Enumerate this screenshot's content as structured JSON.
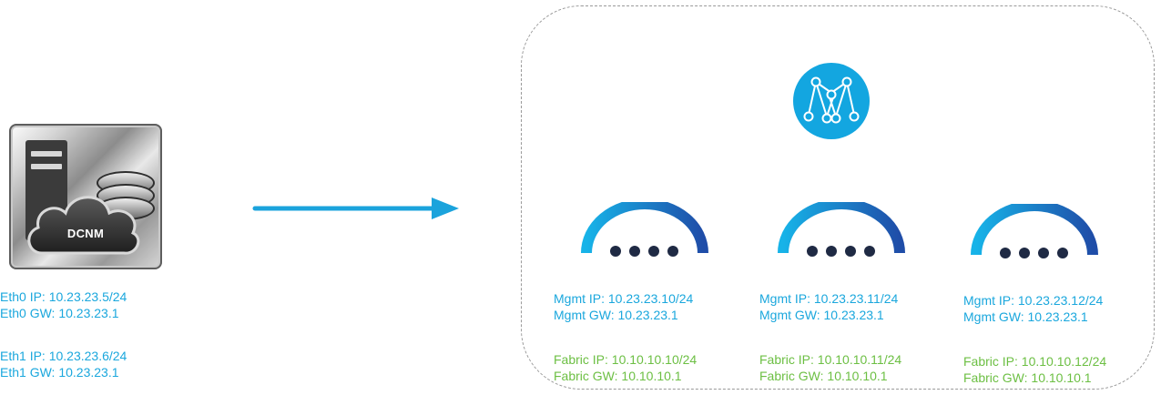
{
  "dcnm": {
    "label": "DCNM",
    "eth0_ip": "Eth0 IP: 10.23.23.5/24",
    "eth0_gw": "Eth0 GW: 10.23.23.1",
    "eth1_ip": "Eth1 IP: 10.23.23.6/24",
    "eth1_gw": "Eth1 GW: 10.23.23.1"
  },
  "nodes": [
    {
      "mgmt_ip": "Mgmt IP: 10.23.23.10/24",
      "mgmt_gw": "Mgmt GW: 10.23.23.1",
      "fabric_ip": "Fabric IP: 10.10.10.10/24",
      "fabric_gw": "Fabric GW: 10.10.10.1"
    },
    {
      "mgmt_ip": "Mgmt IP: 10.23.23.11/24",
      "mgmt_gw": "Mgmt GW: 10.23.23.1",
      "fabric_ip": "Fabric IP: 10.10.10.11/24",
      "fabric_gw": "Fabric GW: 10.10.10.1"
    },
    {
      "mgmt_ip": "Mgmt IP: 10.23.23.12/24",
      "mgmt_gw": "Mgmt GW: 10.23.23.1",
      "fabric_ip": "Fabric IP: 10.10.10.12/24",
      "fabric_gw": "Fabric GW: 10.10.10.1"
    }
  ],
  "icons": {
    "dcnm": "dcnm-server-cloud-icon",
    "arrow": "arrow-right-icon",
    "hub": "fabric-hub-icon",
    "node": "cluster-node-icon"
  },
  "colors": {
    "ip_text": "#1aa7dd",
    "fabric_text": "#6cbf43",
    "arrow": "#1ba3dc",
    "hub": "#13a6e0",
    "arc_start": "#17b3e8",
    "arc_end": "#1f4da8",
    "dots": "#1f2a44"
  }
}
